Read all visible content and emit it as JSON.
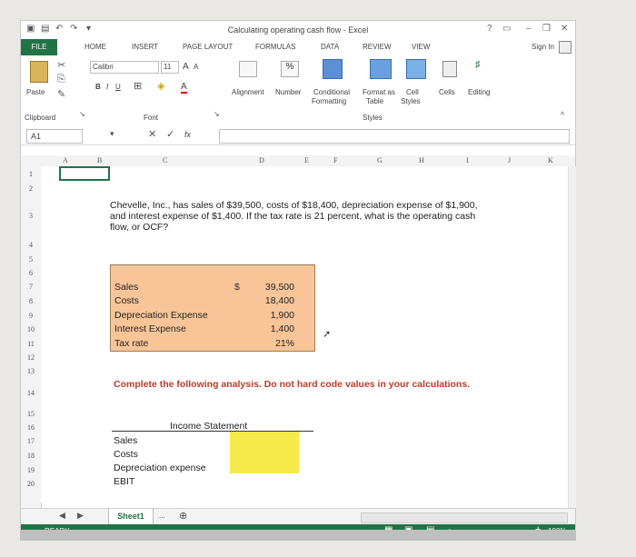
{
  "window": {
    "title": "Calculating operating cash flow - Excel",
    "help": "?",
    "sign_in": "Sign In"
  },
  "tabs": [
    "FILE",
    "HOME",
    "INSERT",
    "PAGE LAYOUT",
    "FORMULAS",
    "DATA",
    "REVIEW",
    "VIEW"
  ],
  "ribbon": {
    "paste": "Paste",
    "clipboard": "Clipboard",
    "font_name": "Calibri",
    "font_size": "11",
    "font_group": "Font",
    "bold": "B",
    "italic": "I",
    "underline": "U",
    "grow_font": "A",
    "shrink_font": "A",
    "alignment": "Alignment",
    "number": "Number",
    "percent": "%",
    "conditional": "Conditional",
    "formatting": "Formatting",
    "format_as": "Format as",
    "table": "Table",
    "cell": "Cell",
    "styles_btn": "Styles",
    "styles_group": "Styles",
    "cells": "Cells",
    "editing": "Editing"
  },
  "formula_bar": {
    "name_box": "A1",
    "fx": "fx",
    "value": ""
  },
  "columns": [
    "A",
    "B",
    "C",
    "D",
    "E",
    "F",
    "G",
    "H",
    "I",
    "J",
    "K"
  ],
  "rows": [
    "1",
    "2",
    "3",
    "4",
    "5",
    "6",
    "7",
    "8",
    "9",
    "10",
    "11",
    "12",
    "13",
    "14",
    "15",
    "16",
    "17",
    "18",
    "19",
    "20"
  ],
  "problem": "Chevelle, Inc., has sales of $39,500, costs of $18,400, depreciation expense of $1,900, and interest expense of $1,400. If the tax rate is 21 percent, what is the operating cash flow, or OCF?",
  "inputs": {
    "labels": [
      "Sales",
      "Costs",
      "Depreciation Expense",
      "Interest Expense",
      "Tax rate"
    ],
    "currency": "$",
    "values": [
      "39,500",
      "18,400",
      "1,900",
      "1,400",
      "21%"
    ]
  },
  "instruction": "Complete the following analysis. Do not hard code values in your calculations.",
  "income_statement": {
    "title": "Income Statement",
    "labels": [
      "Sales",
      "Costs",
      "Depreciation expense",
      "EBIT"
    ]
  },
  "sheet_tab": "Sheet1",
  "status": {
    "ready": "READY",
    "zoom": "100%",
    "ellipsis": "..."
  },
  "colors": {
    "excel_green": "#217346",
    "input_fill": "#f9c598",
    "answer_fill": "#f5ea4a",
    "instruction_red": "#c0392b"
  }
}
